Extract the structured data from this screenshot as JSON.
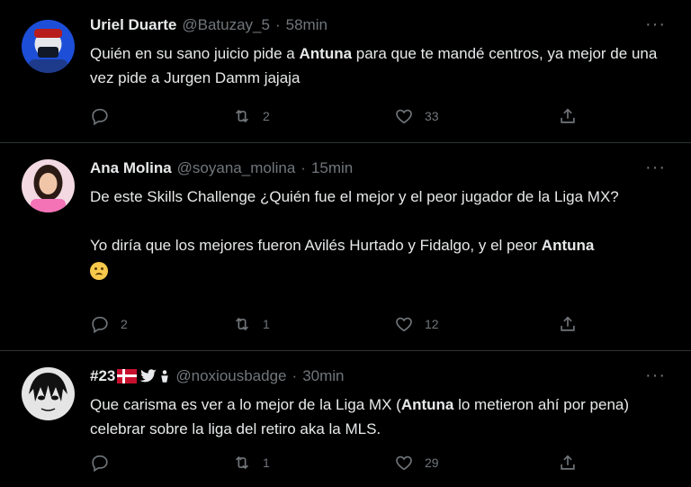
{
  "tweets": [
    {
      "name": "Uriel Duarte",
      "handle": "@Batuzay_5",
      "dot": "·",
      "time": "58min",
      "text_parts": [
        "Quién en su sano juicio pide a ",
        "Antuna",
        " para que te mandé centros, ya mejor de una vez pide a Jurgen Damm jajaja"
      ],
      "replies": "",
      "retweets": "2",
      "likes": "33"
    },
    {
      "name": "Ana Molina",
      "handle": "@soyana_molina",
      "dot": "·",
      "time": "15min",
      "text_parts": [
        "De este Skills Challenge ¿Quién fue el mejor y el peor jugador de la Liga MX?\n\nYo diría que los mejores fueron Avilés Hurtado y Fidalgo, y el peor ",
        "Antuna",
        ""
      ],
      "replies": "2",
      "retweets": "1",
      "likes": "12"
    },
    {
      "name": "#23",
      "handle": "@noxiousbadge",
      "dot": "·",
      "time": "30min",
      "text_parts": [
        "Que carisma es ver a lo mejor de la Liga MX (",
        "Antuna",
        " lo metieron ahí por pena) celebrar sobre la liga del retiro aka la MLS."
      ],
      "replies": "",
      "retweets": "1",
      "likes": "29"
    }
  ],
  "icons": {
    "reply": "reply-icon",
    "retweet": "retweet-icon",
    "like": "heart-icon",
    "share": "share-icon",
    "more": "more-icon"
  },
  "more_glyph": "···",
  "colors": {
    "background": "#000000",
    "text": "#e7e9ea",
    "muted": "#71767b",
    "divider": "#2f3336"
  }
}
